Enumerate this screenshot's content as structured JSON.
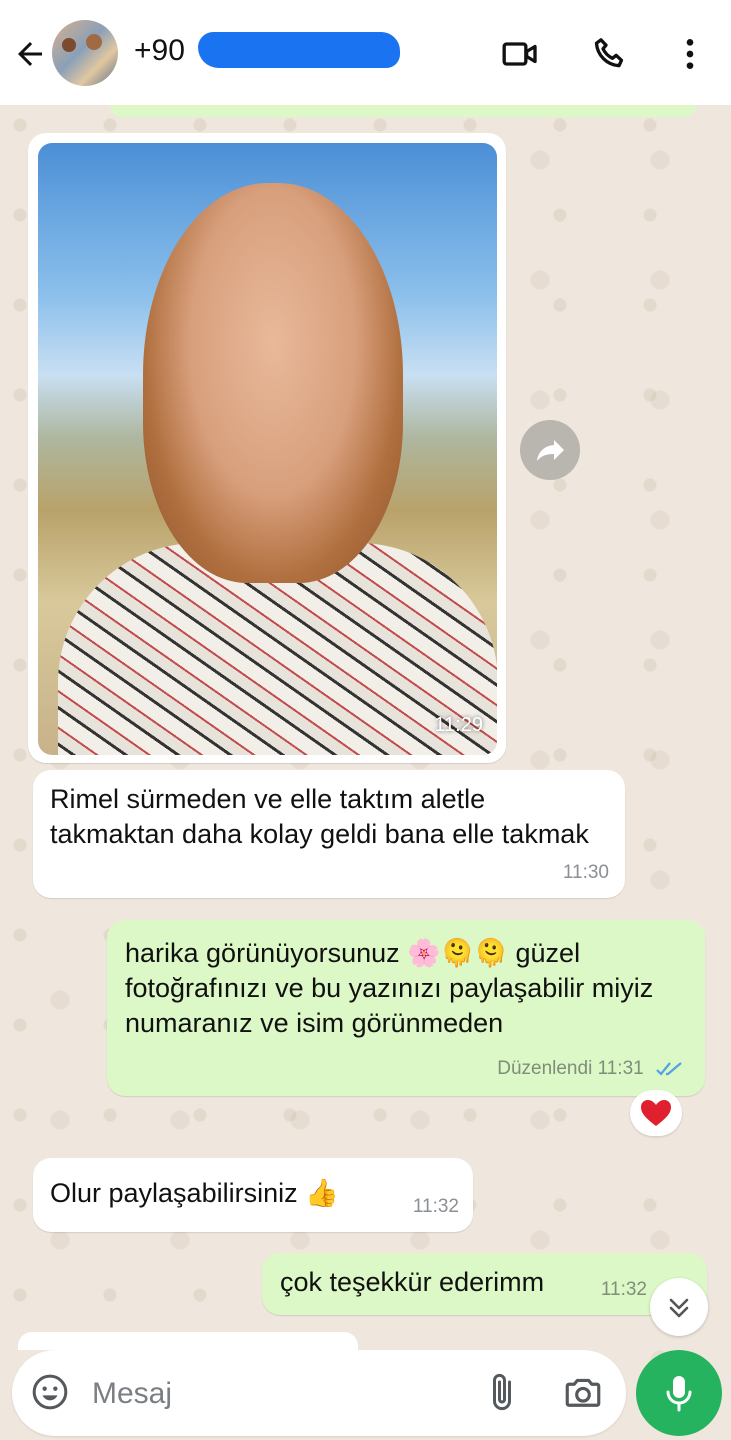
{
  "header": {
    "contact_prefix": "+90",
    "icons": [
      "back-arrow-icon",
      "avatar",
      "video-call-icon",
      "phone-icon",
      "more-vert-icon"
    ]
  },
  "messages": [
    {
      "direction": "in",
      "type": "image",
      "time": "11:29"
    },
    {
      "direction": "in",
      "text": "Rimel sürmeden ve elle taktım aletle takmaktan daha kolay geldi bana elle takmak",
      "time": "11:30"
    },
    {
      "direction": "out",
      "text": "harika görünüyorsunuz 🌸🫠🫠 güzel fotoğrafınızı ve bu yazınızı paylaşabilir miyiz numaranız ve isim görünmeden",
      "edited_label": "Düzenlendi",
      "time": "11:31",
      "reaction": "❤️"
    },
    {
      "direction": "in",
      "text": "Olur paylaşabilirsiniz 👍",
      "time": "11:32"
    },
    {
      "direction": "out",
      "text": "çok teşekkür ederimm",
      "time": "11:32"
    }
  ],
  "composer": {
    "placeholder": "Mesaj"
  },
  "colors": {
    "incoming_bubble": "#ffffff",
    "outgoing_bubble": "#dcf8c6",
    "wallpaper": "#efe7dd",
    "mic_button": "#25b35f",
    "read_ticks": "#4fa3e0"
  }
}
